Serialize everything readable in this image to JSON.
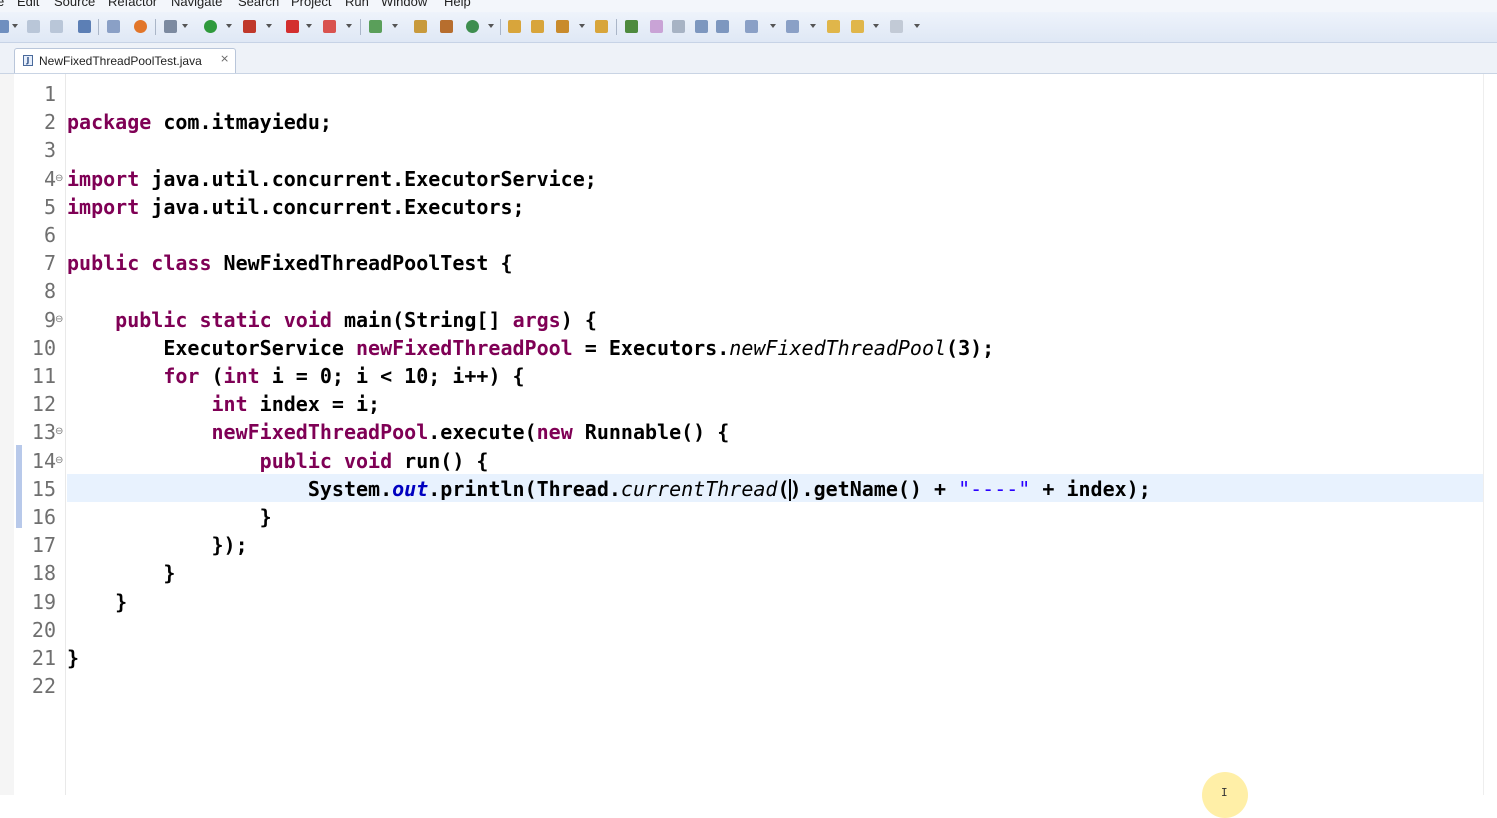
{
  "menu": {
    "items": [
      "e",
      "Edit",
      "Source",
      "Refactor",
      "Navigate",
      "Search",
      "Project",
      "Run",
      "Window",
      "Help"
    ]
  },
  "editor_tab": {
    "title": "NewFixedThreadPoolTest.java",
    "icon": "java-file-icon",
    "close_glyph": "⨯"
  },
  "colors": {
    "keyword": "#7f0055",
    "field": "#0000c0",
    "string": "#2a00ff",
    "current_line": "#e8f2fe",
    "line_number": "#6f6f6f"
  },
  "line_numbers": [
    "1",
    "2",
    "3",
    "4",
    "5",
    "6",
    "7",
    "8",
    "9",
    "10",
    "11",
    "12",
    "13",
    "14",
    "15",
    "16",
    "17",
    "18",
    "19",
    "20",
    "21",
    "22"
  ],
  "code": {
    "l2_kw": "package",
    "l2_rest": " com.itmayiedu;",
    "l4_kw": "import",
    "l4_rest": " java.util.concurrent.ExecutorService;",
    "l5_kw": "import",
    "l5_rest": " java.util.concurrent.Executors;",
    "l7_kw1": "public",
    "l7_kw2": "class",
    "l7_rest": " NewFixedThreadPoolTest {",
    "l9_kw1": "public",
    "l9_kw2": "static",
    "l9_kw3": "void",
    "l9_a": " main(String[] ",
    "l9_param": "args",
    "l9_b": ") {",
    "l10_a": "ExecutorService ",
    "l10_var": "newFixedThreadPool",
    "l10_b": " = Executors.",
    "l10_meth": "newFixedThreadPool",
    "l10_c": "(3);",
    "l11_kw1": "for",
    "l11_a": " (",
    "l11_kw2": "int",
    "l11_b": " i = 0; i < 10; i++) {",
    "l12_kw": "int",
    "l12_rest": " index = i;",
    "l13_var": "newFixedThreadPool",
    "l13_a": ".execute(",
    "l13_kw": "new",
    "l13_b": " Runnable() {",
    "l14_kw1": "public",
    "l14_kw2": "void",
    "l14_rest": " run() {",
    "l15_a": "System.",
    "l15_out": "out",
    "l15_b": ".println(Thread.",
    "l15_meth": "currentThread",
    "l15_c1": "(",
    "l15_c2": ").getName() + ",
    "l15_str": "\"----\"",
    "l15_d": " + index);",
    "l16": "}",
    "l17": "});",
    "l18": "}",
    "l19": "}",
    "l21": "}"
  }
}
